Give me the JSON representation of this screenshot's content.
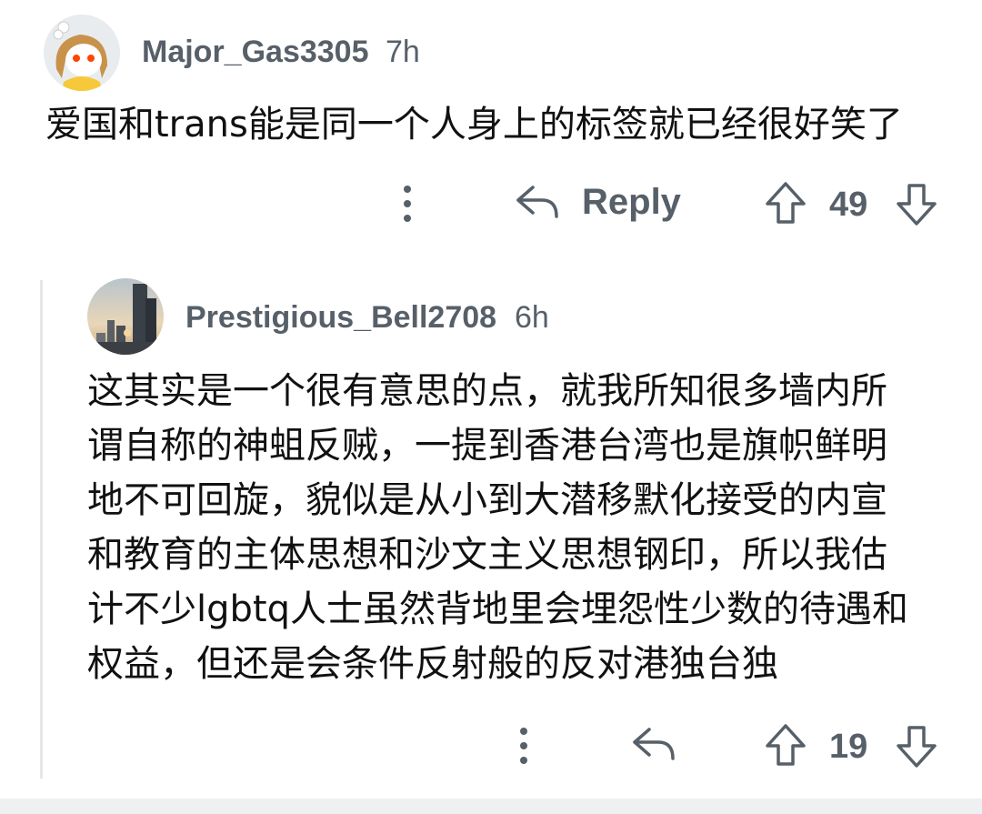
{
  "comment1": {
    "author": "Major_Gas3305",
    "time": "7h",
    "body": "爱国和trans能是同一个人身上的标签就已经很好笑了",
    "reply_label": "Reply",
    "score": "49",
    "icons": [
      "more-icon",
      "reply-icon",
      "upvote-icon",
      "downvote-icon"
    ]
  },
  "comment2": {
    "author": "Prestigious_Bell2708",
    "time": "6h",
    "body_lines": [
      "这其实是一个很有意思的点，就我所知很多墙内所",
      "谓自称的神蛆反贼，一提到香港台湾也是旗帜鲜明",
      "地不可回旋，貌似是从小到大潜移默化接受的内宣",
      "和教育的主体思想和沙文主义思想钢印，所以我估",
      "计不少lgbtq人士虽然背地里会埋怨性少数的待遇和",
      "权益，但还是会条件反射般的反对港独台独"
    ],
    "score": "19",
    "icons": [
      "more-icon",
      "reply-icon",
      "upvote-icon",
      "downvote-icon"
    ]
  },
  "colors": {
    "meta_text": "#576069",
    "body_text": "#111111",
    "thread_line": "#e4e6e8"
  }
}
